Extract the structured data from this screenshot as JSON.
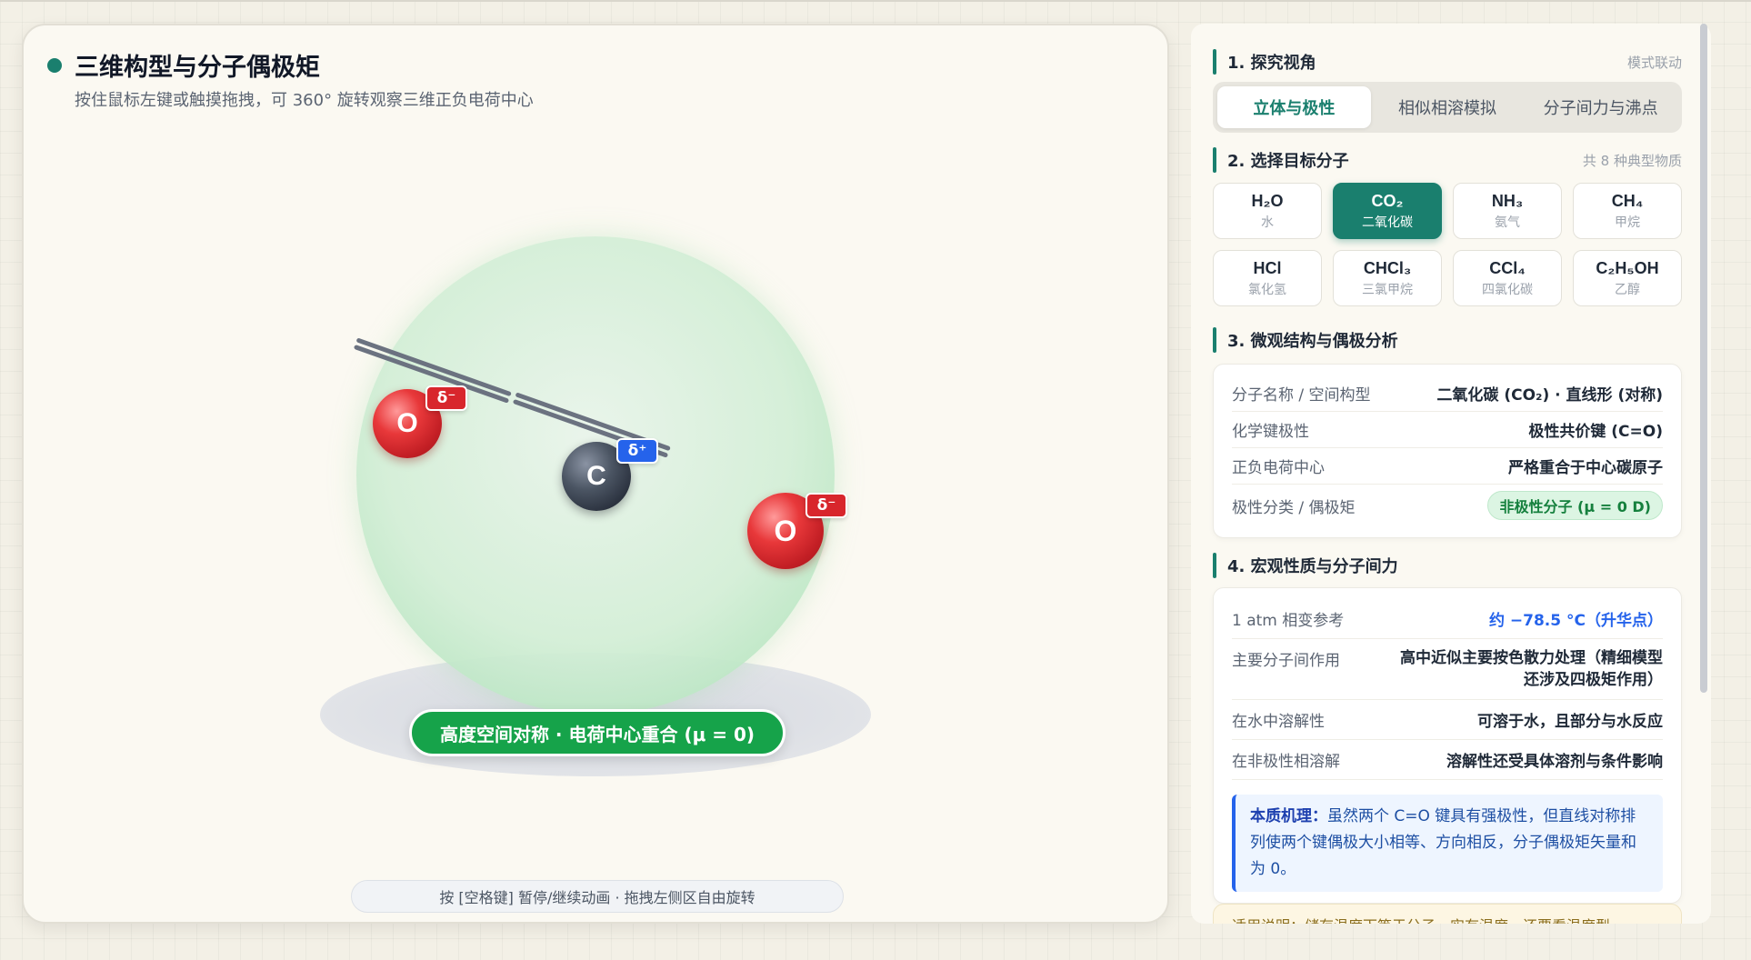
{
  "viewer": {
    "title": "三维构型与分子偶极矩",
    "subtitle": "按住鼠标左键或触摸拖拽，可 360° 旋转观察三维正负电荷中心",
    "atoms": {
      "o_left": "O",
      "carbon": "C",
      "o_right": "O"
    },
    "charges": {
      "o_left": "δ⁻",
      "carbon": "δ⁺",
      "o_right": "δ⁻"
    },
    "verdict": "高度空间对称 · 电荷中心重合 (μ = 0)",
    "hint": "按 [空格键] 暂停/继续动画 · 拖拽左侧区自由旋转",
    "colors": {
      "oxygen": "#d8262c",
      "carbon": "#2c3340",
      "positive_badge": "#2563eb",
      "verdict_green": "#16a34a"
    }
  },
  "sidebar": {
    "section1": {
      "title": "1. 探究视角",
      "aside": "模式联动"
    },
    "tabs": [
      {
        "label": "立体与极性",
        "active": true
      },
      {
        "label": "相似相溶模拟",
        "active": false
      },
      {
        "label": "分子间力与沸点",
        "active": false
      }
    ],
    "section2": {
      "title": "2. 选择目标分子",
      "aside": "共 8 种典型物质"
    },
    "molecules": [
      {
        "formula": "H₂O",
        "name": "水",
        "active": false
      },
      {
        "formula": "CO₂",
        "name": "二氧化碳",
        "active": true
      },
      {
        "formula": "NH₃",
        "name": "氨气",
        "active": false
      },
      {
        "formula": "CH₄",
        "name": "甲烷",
        "active": false
      },
      {
        "formula": "HCl",
        "name": "氯化氢",
        "active": false
      },
      {
        "formula": "CHCl₃",
        "name": "三氯甲烷",
        "active": false
      },
      {
        "formula": "CCl₄",
        "name": "四氯化碳",
        "active": false
      },
      {
        "formula": "C₂H₅OH",
        "name": "乙醇",
        "active": false
      }
    ],
    "section3": {
      "title": "3. 微观结构与偶极分析"
    },
    "structure": {
      "name_key": "分子名称 / 空间构型",
      "name_val": "二氧化碳 (CO₂) · 直线形 (对称)",
      "bond_key": "化学键极性",
      "bond_val": "极性共价键 (C=O)",
      "center_key": "正负电荷中心",
      "center_val": "严格重合于中心碳原子",
      "polarity_key": "极性分类 / 偶极矩",
      "polarity_val": "非极性分子 (μ = 0 D)"
    },
    "section4": {
      "title": "4. 宏观性质与分子间力"
    },
    "macro": {
      "phase_key": "1 atm 相变参考",
      "phase_val": "约 −78.5 °C（升华点）",
      "force_key": "主要分子间作用",
      "force_val": "高中近似主要按色散力处理（精细模型还涉及四极矩作用）",
      "water_key": "在水中溶解性",
      "water_val": "可溶于水，且部分与水反应",
      "nonpolar_key": "在非极性相溶解",
      "nonpolar_val": "溶解性还受具体溶剂与条件影响",
      "note_label": "本质机理：",
      "note_text": "虽然两个 C=O 键具有强极性，但直线对称排列使两个键偶极大小相等、方向相反，分子偶极矩矢量和为 0。"
    },
    "peek_text": "适用说明：储存温度下等于分子，实有温度，还要看温度型"
  }
}
